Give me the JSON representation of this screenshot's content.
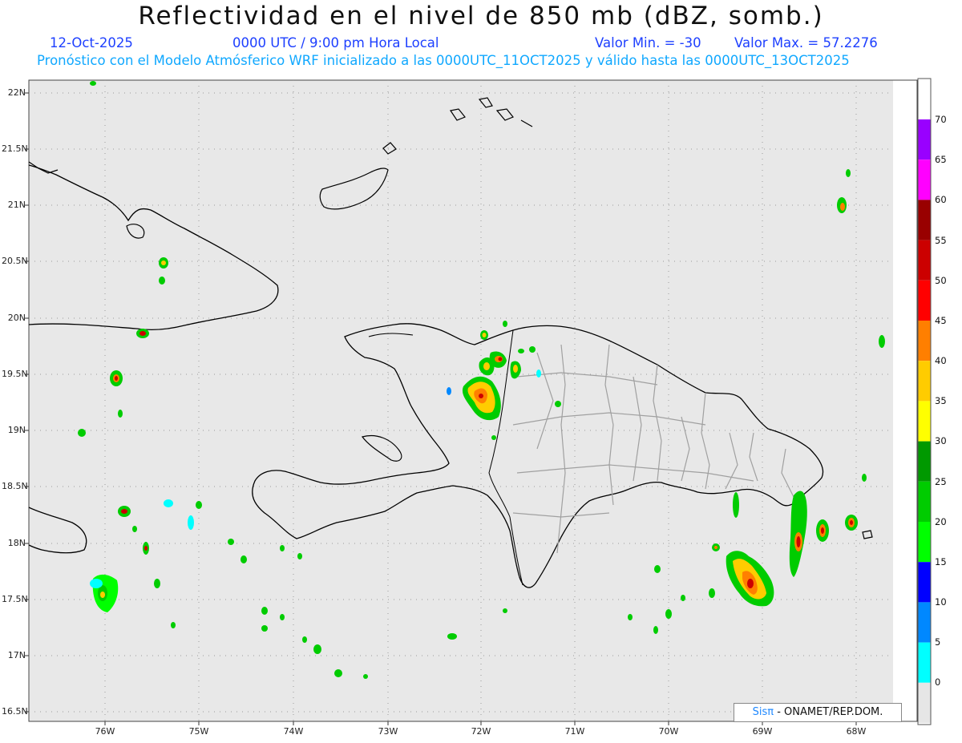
{
  "header": {
    "title": "Reflectividad en el nivel de 850 mb (dBZ, somb.)",
    "date": "12-Oct-2025",
    "time": "0000 UTC / 9:00 pm Hora Local",
    "min_label": "Valor Min. = -30",
    "max_label": "Valor Max. = 57.2276",
    "forecast_note": "Pronóstico con el Modelo Atmósferico WRF inicializado a las 0000UTC_11OCT2025 y válido hasta las  0000UTC_13OCT2025"
  },
  "axes": {
    "lat_labels": [
      "22N",
      "21.5N",
      "21N",
      "20.5N",
      "20N",
      "19.5N",
      "19N",
      "18.5N",
      "18N",
      "17.5N",
      "17N",
      "16.5N"
    ],
    "lon_labels": [
      "76W",
      "75W",
      "74W",
      "73W",
      "72W",
      "71W",
      "70W",
      "69W",
      "68W"
    ]
  },
  "colorbar": {
    "labels": [
      "70",
      "65",
      "60",
      "55",
      "50",
      "45",
      "40",
      "35",
      "30",
      "25",
      "20",
      "15",
      "10",
      "5",
      "0"
    ],
    "colors": [
      "#9900ff",
      "#ff00ff",
      "#990000",
      "#cc0000",
      "#ff0000",
      "#ff7f00",
      "#ffcc00",
      "#ffff00",
      "#009900",
      "#00cc00",
      "#00ff00",
      "#0000ff",
      "#0088ff",
      "#00ffff",
      "#e6e6e6"
    ]
  },
  "credit": {
    "sis": "Sisπ",
    "org": " - ONAMET/REP.DOM."
  },
  "style": {
    "map_background": "#e8e8e8",
    "coastline": "#000000",
    "provinces": "#a0a0a0"
  }
}
